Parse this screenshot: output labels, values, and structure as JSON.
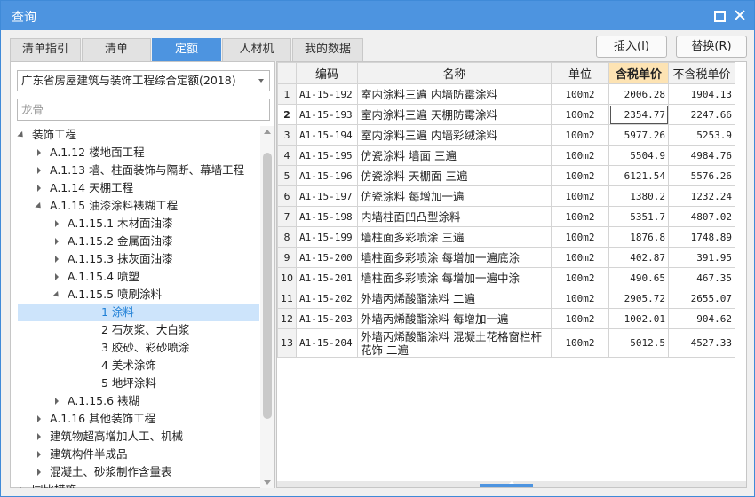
{
  "window": {
    "title": "查询"
  },
  "tabs": [
    {
      "label": "清单指引"
    },
    {
      "label": "清单"
    },
    {
      "label": "定额",
      "active": true
    },
    {
      "label": "人材机"
    },
    {
      "label": "我的数据"
    }
  ],
  "actions": {
    "insert": "插入(I)",
    "replace": "替换(R)"
  },
  "left": {
    "library": "广东省房屋建筑与装饰工程综合定额(2018)",
    "search_placeholder": "龙骨",
    "tree": [
      {
        "label": "装饰工程",
        "level": 0,
        "state": "open"
      },
      {
        "label": "A.1.12 楼地面工程",
        "level": 1,
        "state": "closed"
      },
      {
        "label": "A.1.13 墙、柱面装饰与隔断、幕墙工程",
        "level": 1,
        "state": "closed"
      },
      {
        "label": "A.1.14 天棚工程",
        "level": 1,
        "state": "closed"
      },
      {
        "label": "A.1.15 油漆涂料裱糊工程",
        "level": 1,
        "state": "open"
      },
      {
        "label": "A.1.15.1 木材面油漆",
        "level": 2,
        "state": "closed"
      },
      {
        "label": "A.1.15.2 金属面油漆",
        "level": 2,
        "state": "closed"
      },
      {
        "label": "A.1.15.3 抹灰面油漆",
        "level": 2,
        "state": "closed"
      },
      {
        "label": "A.1.15.4 喷塑",
        "level": 2,
        "state": "closed"
      },
      {
        "label": "A.1.15.5 喷刷涂料",
        "level": 2,
        "state": "open"
      },
      {
        "label": "1 涂料",
        "level": 3,
        "state": "leaf",
        "selected": true
      },
      {
        "label": "2 石灰浆、大白浆",
        "level": 3,
        "state": "leaf"
      },
      {
        "label": "3 胶砂、彩砂喷涂",
        "level": 3,
        "state": "leaf"
      },
      {
        "label": "4 美术涂饰",
        "level": 3,
        "state": "leaf"
      },
      {
        "label": "5 地坪涂料",
        "level": 3,
        "state": "leaf"
      },
      {
        "label": "A.1.15.6 裱糊",
        "level": 2,
        "state": "closed"
      },
      {
        "label": "A.1.16 其他装饰工程",
        "level": 1,
        "state": "closed"
      },
      {
        "label": "建筑物超高增加人工、机械",
        "level": 1,
        "state": "closed"
      },
      {
        "label": "建筑构件半成品",
        "level": 1,
        "state": "closed"
      },
      {
        "label": "混凝土、砂浆制作含量表",
        "level": 1,
        "state": "closed"
      },
      {
        "label": "同比措施",
        "level": 0,
        "state": "closed"
      }
    ]
  },
  "table": {
    "columns": [
      "",
      "编码",
      "名称",
      "单位",
      "含税单价",
      "不含税单价"
    ],
    "rows": [
      {
        "idx": "1",
        "code": "A1-15-192",
        "name": "室内涂料三遍 内墙防霉涂料",
        "unit": "100m2",
        "tax_price": "2006.28",
        "notax_price": "1904.13"
      },
      {
        "idx": "2",
        "code": "A1-15-193",
        "name": "室内涂料三遍 天棚防霉涂料",
        "unit": "100m2",
        "tax_price": "2354.77",
        "notax_price": "2247.66"
      },
      {
        "idx": "3",
        "code": "A1-15-194",
        "name": "室内涂料三遍 内墙彩绒涂料",
        "unit": "100m2",
        "tax_price": "5977.26",
        "notax_price": "5253.9"
      },
      {
        "idx": "4",
        "code": "A1-15-195",
        "name": "仿瓷涂料 墙面 三遍",
        "unit": "100m2",
        "tax_price": "5504.9",
        "notax_price": "4984.76"
      },
      {
        "idx": "5",
        "code": "A1-15-196",
        "name": "仿瓷涂料 天棚面 三遍",
        "unit": "100m2",
        "tax_price": "6121.54",
        "notax_price": "5576.26"
      },
      {
        "idx": "6",
        "code": "A1-15-197",
        "name": "仿瓷涂料 每增加一遍",
        "unit": "100m2",
        "tax_price": "1380.2",
        "notax_price": "1232.24"
      },
      {
        "idx": "7",
        "code": "A1-15-198",
        "name": "内墙柱面凹凸型涂料",
        "unit": "100m2",
        "tax_price": "5351.7",
        "notax_price": "4807.02"
      },
      {
        "idx": "8",
        "code": "A1-15-199",
        "name": "墙柱面多彩喷涂 三遍",
        "unit": "100m2",
        "tax_price": "1876.8",
        "notax_price": "1748.89"
      },
      {
        "idx": "9",
        "code": "A1-15-200",
        "name": "墙柱面多彩喷涂 每增加一遍底涂",
        "unit": "100m2",
        "tax_price": "402.87",
        "notax_price": "391.95"
      },
      {
        "idx": "10",
        "code": "A1-15-201",
        "name": "墙柱面多彩喷涂 每增加一遍中涂",
        "unit": "100m2",
        "tax_price": "490.65",
        "notax_price": "467.35"
      },
      {
        "idx": "11",
        "code": "A1-15-202",
        "name": "外墙丙烯酸酯涂料 二遍",
        "unit": "100m2",
        "tax_price": "2905.72",
        "notax_price": "2655.07"
      },
      {
        "idx": "12",
        "code": "A1-15-203",
        "name": "外墙丙烯酸酯涂料 每增加一遍",
        "unit": "100m2",
        "tax_price": "1002.01",
        "notax_price": "904.62"
      },
      {
        "idx": "13",
        "code": "A1-15-204",
        "name": "外墙丙烯酸酯涂料 混凝土花格窗栏杆花饰 二遍",
        "unit": "100m2",
        "tax_price": "5012.5",
        "notax_price": "4527.33"
      }
    ]
  }
}
